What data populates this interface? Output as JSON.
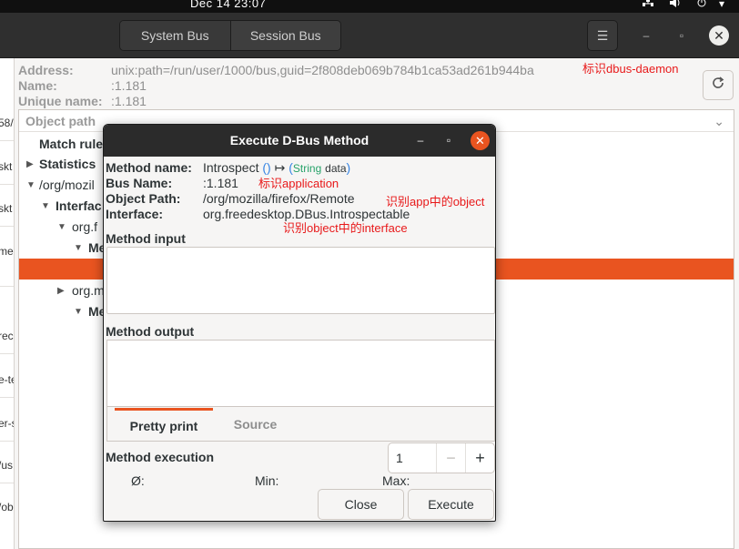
{
  "topbar": {
    "clock": "Dec 14  23:07",
    "tray_icons": [
      "network-icon",
      "volume-icon",
      "power-icon"
    ]
  },
  "header": {
    "system_bus_label": "System Bus",
    "session_bus_label": "Session Bus",
    "menu_icon": "☰",
    "minimize_icon": "–",
    "maximize_icon": "▫",
    "close_icon": "✕"
  },
  "left_list": {
    "fragments": [
      "58/",
      "skt",
      "skt",
      "me",
      "rec",
      "e-te",
      "er-s",
      "/us",
      "/ob"
    ]
  },
  "info": {
    "address_label": "Address:",
    "address_value": "unix:path=/run/user/1000/bus,guid=2f808deb069b784b1ca53ad261b944ba",
    "name_label": "Name:",
    "name_value": ":1.181",
    "unique_name_label": "Unique name:",
    "unique_name_value": ":1.181",
    "annotation_daemon": "标识dbus-daemon"
  },
  "tree": {
    "header_label": "Object path",
    "rows": {
      "match_rules": "Match rule",
      "statistics": "Statistics",
      "object_path": "/org/mozil",
      "interfaces": "Interfac",
      "org_f": "org.f",
      "methods_1": "Me",
      "org_m": "org.m",
      "methods_2": "Me"
    }
  },
  "dialog": {
    "title": "Execute D-Bus Method",
    "method_name_label": "Method name:",
    "method_name": "Introspect",
    "sig_open": "()",
    "sig_arrow": "↦",
    "sig_lparen": "(",
    "sig_type": "String",
    "sig_arg": "data",
    "sig_rparen": ")",
    "bus_name_label": "Bus Name:",
    "bus_name": ":1.181",
    "object_path_label": "Object Path:",
    "object_path": "/org/mozilla/firefox/Remote",
    "interface_label": "Interface:",
    "interface": "org.freedesktop.DBus.Introspectable",
    "annotation_application": "标识application",
    "annotation_object": "识别app中的object",
    "annotation_interface": "识别object中的interface",
    "method_input_label": "Method input",
    "method_output_label": "Method output",
    "tab_pretty": "Pretty print",
    "tab_source": "Source",
    "method_execution_label": "Method execution",
    "repeat_count": "1",
    "minus": "−",
    "plus": "+",
    "avg_label": "Ø:",
    "min_label": "Min:",
    "max_label": "Max:",
    "close_button": "Close",
    "execute_button": "Execute"
  },
  "colors": {
    "accent": "#e95420",
    "annotation": "#e8191a",
    "headerbar": "#2f2f2f"
  }
}
